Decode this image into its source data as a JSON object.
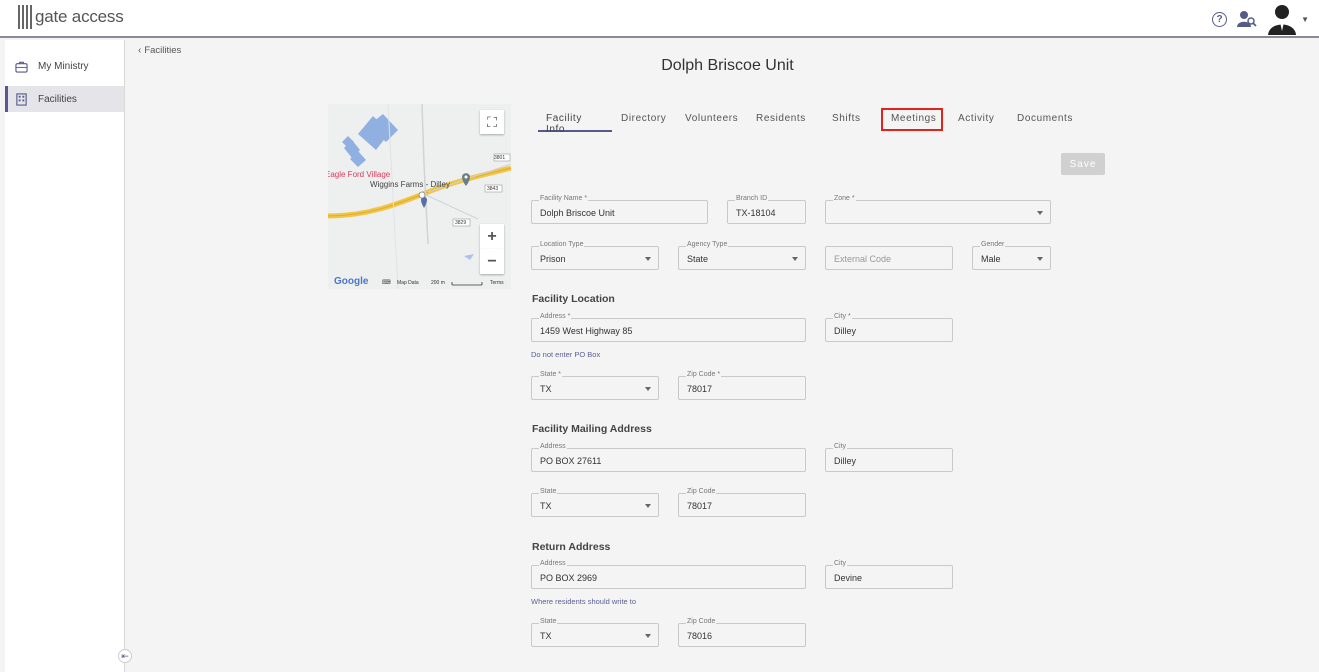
{
  "app": {
    "logo_text": "gate access"
  },
  "topbar": {
    "help_icon": "help-circle-icon",
    "user_search_icon": "user-search-icon",
    "avatar_icon": "avatar-icon"
  },
  "sidebar": {
    "items": [
      {
        "label": "My Ministry",
        "icon": "briefcase-icon",
        "active": false
      },
      {
        "label": "Facilities",
        "icon": "building-icon",
        "active": true
      }
    ]
  },
  "breadcrumb": {
    "back_label": "Facilities"
  },
  "page": {
    "title": "Dolph Briscoe Unit"
  },
  "map": {
    "place_1": "Eagle Ford Village",
    "place_2": "Wiggins Farms - Dilley",
    "road_labels": [
      "3801",
      "3843",
      "3829"
    ],
    "google": "Google",
    "map_data": "Map Data",
    "scale": "200 m",
    "terms": "Terms"
  },
  "tabs": [
    {
      "label": "Facility Info",
      "active": true,
      "highlight": false
    },
    {
      "label": "Directory",
      "active": false,
      "highlight": false
    },
    {
      "label": "Volunteers",
      "active": false,
      "highlight": false
    },
    {
      "label": "Residents",
      "active": false,
      "highlight": false
    },
    {
      "label": "Shifts",
      "active": false,
      "highlight": false
    },
    {
      "label": "Meetings",
      "active": false,
      "highlight": true
    },
    {
      "label": "Activity",
      "active": false,
      "highlight": false
    },
    {
      "label": "Documents",
      "active": false,
      "highlight": false
    }
  ],
  "save_label": "Save",
  "facility": {
    "name": {
      "label": "Facility Name *",
      "value": "Dolph Briscoe Unit"
    },
    "branch": {
      "label": "Branch ID",
      "value": "TX-18104"
    },
    "zone": {
      "label": "Zone *",
      "value": ""
    },
    "location_type": {
      "label": "Location Type",
      "value": "Prison"
    },
    "agency_type": {
      "label": "Agency Type",
      "value": "State"
    },
    "external_code": {
      "placeholder": "External Code"
    },
    "gender": {
      "label": "Gender",
      "value": "Male"
    }
  },
  "location": {
    "title": "Facility Location",
    "address": {
      "label": "Address *",
      "value": "1459 West Highway 85"
    },
    "city": {
      "label": "City *",
      "value": "Dilley"
    },
    "hint": "Do not enter PO Box",
    "state": {
      "label": "State *",
      "value": "TX"
    },
    "zip": {
      "label": "Zip Code *",
      "value": "78017"
    }
  },
  "mailing": {
    "title": "Facility Mailing Address",
    "address": {
      "label": "Address",
      "value": "PO BOX 27611"
    },
    "city": {
      "label": "City",
      "value": "Dilley"
    },
    "state": {
      "label": "State",
      "value": "TX"
    },
    "zip": {
      "label": "Zip Code",
      "value": "78017"
    }
  },
  "return": {
    "title": "Return Address",
    "address": {
      "label": "Address",
      "value": "PO BOX 2969"
    },
    "city": {
      "label": "City",
      "value": "Devine"
    },
    "hint": "Where residents should write to",
    "state": {
      "label": "State",
      "value": "TX"
    },
    "zip": {
      "label": "Zip Code",
      "value": "78016"
    }
  },
  "colors": {
    "accent": "#555a8a",
    "highlight": "#e0231b"
  }
}
